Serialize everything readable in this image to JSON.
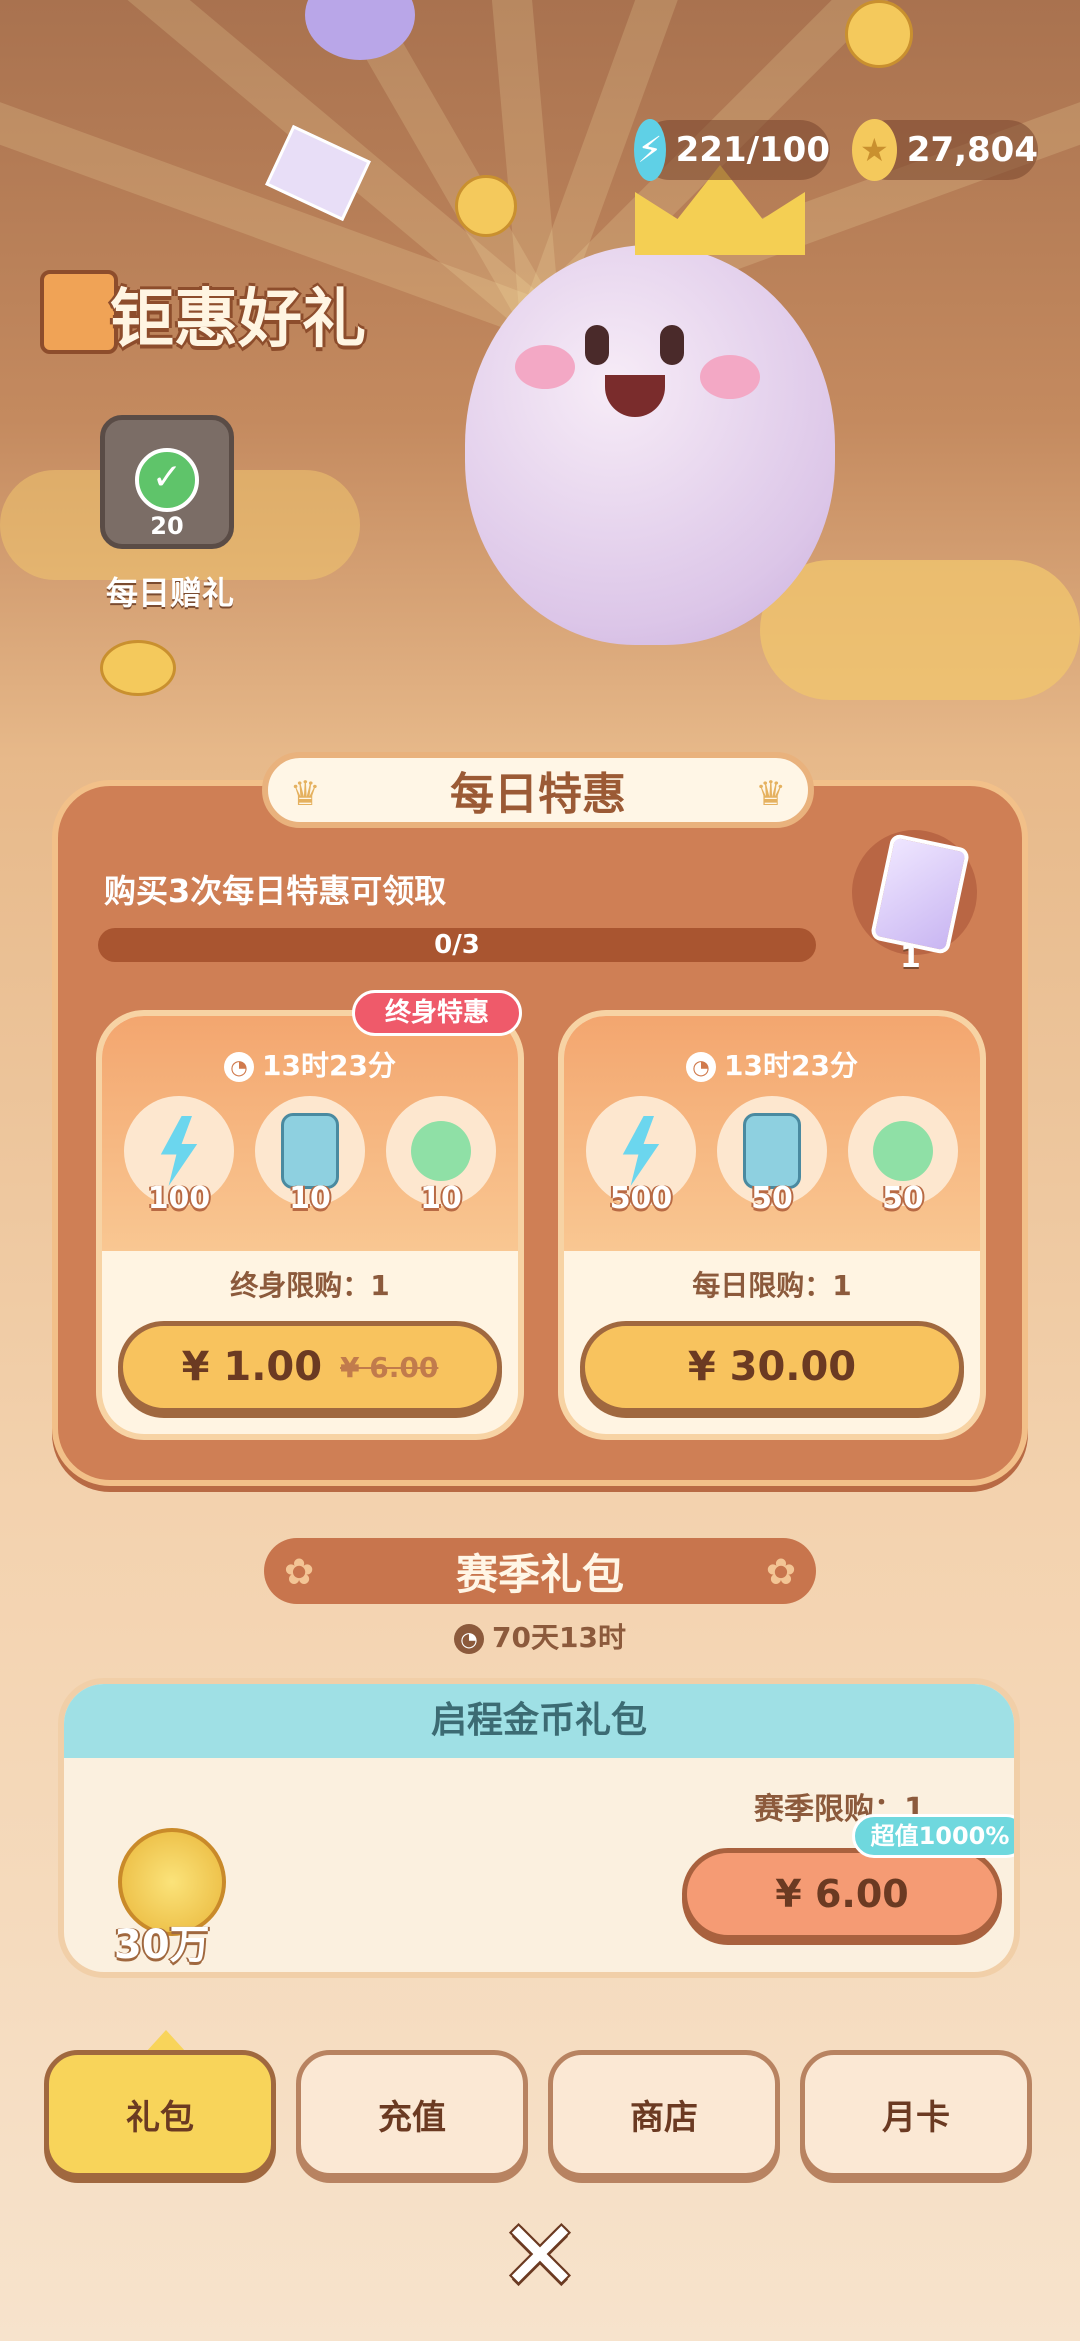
{
  "header": {
    "energy": "221/100",
    "coins": "27,804",
    "title": "钜惠好礼"
  },
  "daily_gift": {
    "label": "每日赠礼",
    "count": "20"
  },
  "daily_special": {
    "title": "每日特惠",
    "requirement": "购买3次每日特惠可领取",
    "progress_label": "0/3",
    "progress_value": 0,
    "reward_count": "1",
    "offers": [
      {
        "badge": "终身特惠",
        "timer": "13时23分",
        "items": [
          {
            "icon": "lightning-icon",
            "num": "100"
          },
          {
            "icon": "card-icon",
            "num": "10"
          },
          {
            "icon": "candy-icon",
            "num": "10"
          }
        ],
        "limit": "终身限购：1",
        "price": "¥ 1.00",
        "old_price": "¥ 6.00"
      },
      {
        "timer": "13时23分",
        "items": [
          {
            "icon": "lightning-icon",
            "num": "500"
          },
          {
            "icon": "card-icon",
            "num": "50"
          },
          {
            "icon": "candy-icon",
            "num": "50"
          }
        ],
        "limit": "每日限购：1",
        "price": "¥ 30.00"
      }
    ]
  },
  "season": {
    "title": "赛季礼包",
    "timer": "70天13时",
    "pack_title": "启程金币礼包",
    "limit": "赛季限购：1",
    "coin_amount": "30万",
    "value_badge": "超值1000%",
    "price": "¥ 6.00"
  },
  "tabs": [
    {
      "label": "礼包",
      "active": true
    },
    {
      "label": "充值"
    },
    {
      "label": "商店"
    },
    {
      "label": "月卡"
    }
  ],
  "colors": {
    "accent": "#f8c35e",
    "panel": "#cf7f55",
    "teal": "#9fe0e5",
    "badge_red": "#ef5a6a"
  }
}
